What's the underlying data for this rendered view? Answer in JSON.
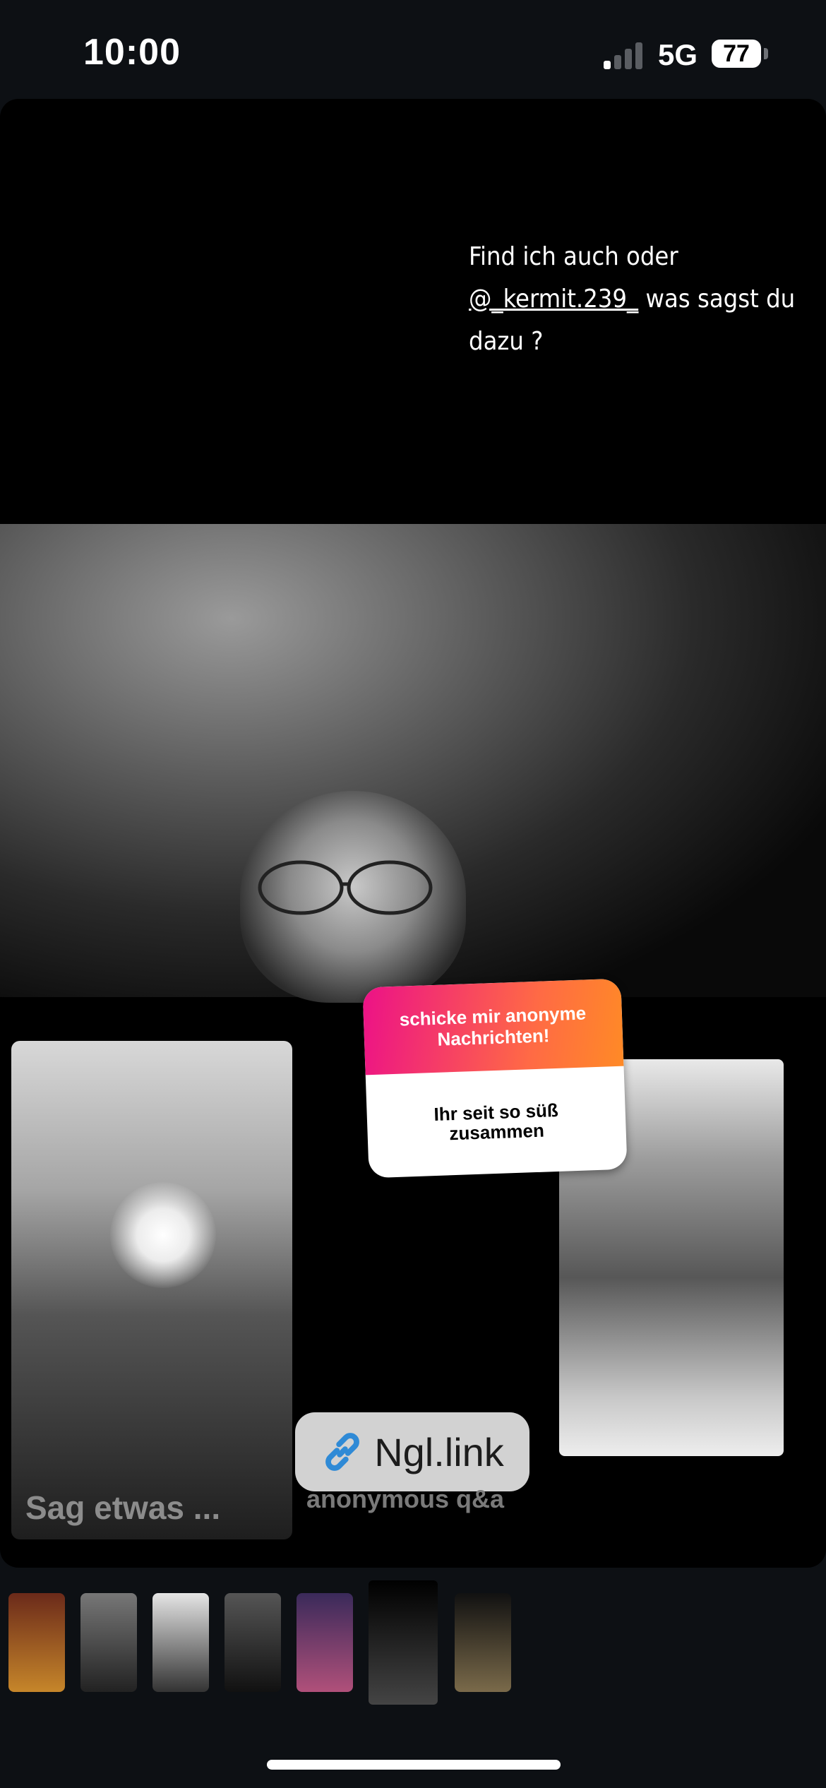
{
  "status_bar": {
    "time": "10:00",
    "network": "5G",
    "battery": "77",
    "signal_bars_active": 1,
    "signal_bars_total": 4
  },
  "story": {
    "caption_line1": "Find ich auch oder",
    "caption_mention": "@_kermit.239_",
    "caption_line2_rest": " was sagst du",
    "caption_line3": "dazu ?",
    "ngl_sticker": {
      "header": "schicke mir anonyme Nachrichten!",
      "message": "Ihr seit so süß zusammen"
    },
    "link_sticker": {
      "label": "Ngl.link",
      "icon": "link-icon"
    },
    "left_photo_text": "Sag etwas ...",
    "anon_text": "anonymous q&a"
  },
  "thumbnails": [
    {
      "name": "story-thumb-1",
      "colors": [
        "#6b2a1a",
        "#c6862a"
      ]
    },
    {
      "name": "story-thumb-2",
      "colors": [
        "#777",
        "#222"
      ]
    },
    {
      "name": "story-thumb-3",
      "colors": [
        "#e5e5e5",
        "#333"
      ]
    },
    {
      "name": "story-thumb-4",
      "colors": [
        "#555",
        "#111"
      ]
    },
    {
      "name": "story-thumb-5",
      "colors": [
        "#3a2a5a",
        "#b0507a"
      ]
    },
    {
      "name": "story-thumb-6",
      "colors": [
        "#000",
        "#444"
      ],
      "active": true
    },
    {
      "name": "story-thumb-7",
      "colors": [
        "#111",
        "#7a6a4a"
      ]
    }
  ],
  "colors": {
    "background": "#0d1014",
    "ngl_gradient_start": "#ec1187",
    "ngl_gradient_end": "#ff8a26"
  }
}
